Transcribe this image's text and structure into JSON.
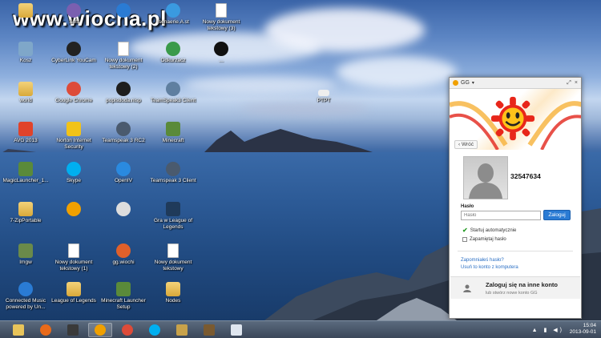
{
  "watermark": "www.wiocha.pl",
  "desktop_icons": [
    {
      "label": "",
      "icon": "folder-icon",
      "color": "#d9a93a",
      "col": 0,
      "row": 0
    },
    {
      "label": "Soft",
      "icon": "app-icon",
      "color": "#7a5fb0",
      "col": 1,
      "row": 0
    },
    {
      "label": "",
      "icon": "app-icon",
      "color": "#2a7bd4",
      "col": 2,
      "row": 0
    },
    {
      "label": "Isenaerie.A.st",
      "icon": "app-icon",
      "color": "#3a9ae0",
      "col": 3,
      "row": 0
    },
    {
      "label": "Nowy dokument tekstowy (3)",
      "icon": "document-icon",
      "color": "#ffffff",
      "col": 4,
      "row": 0
    },
    {
      "label": "Kosz",
      "icon": "recycle-bin-icon",
      "color": "#7fa7c9",
      "col": 0,
      "row": 1
    },
    {
      "label": "CyberLink YouCam",
      "icon": "app-icon",
      "color": "#222222",
      "col": 1,
      "row": 1
    },
    {
      "label": "Nowy dokument tekstowy (2)",
      "icon": "document-icon",
      "color": "#ffffff",
      "col": 2,
      "row": 1
    },
    {
      "label": "Odkurzacz",
      "icon": "app-icon",
      "color": "#3a9a4a",
      "col": 3,
      "row": 1
    },
    {
      "label": "…",
      "icon": "app-icon",
      "color": "#111111",
      "col": 4,
      "row": 1
    },
    {
      "label": "world",
      "icon": "folder-icon",
      "color": "#d9a93a",
      "col": 0,
      "row": 2
    },
    {
      "label": "Google Chrome",
      "icon": "chrome-icon",
      "color": "#dd4b39",
      "col": 1,
      "row": 2
    },
    {
      "label": "popisdoda.nisp",
      "icon": "app-icon",
      "color": "#1e1e1e",
      "col": 2,
      "row": 2
    },
    {
      "label": "TeamSpeak3 Client",
      "icon": "app-icon",
      "color": "#5f7fa0",
      "col": 3,
      "row": 2
    },
    {
      "label": "AVG 2013",
      "icon": "avg-icon",
      "color": "#e0432a",
      "col": 0,
      "row": 3
    },
    {
      "label": "Norton Internet Security",
      "icon": "norton-icon",
      "color": "#f2c318",
      "col": 1,
      "row": 3
    },
    {
      "label": "Teamspeak 3 RC2",
      "icon": "app-icon",
      "color": "#4a5a6e",
      "col": 2,
      "row": 3
    },
    {
      "label": "Minecraft",
      "icon": "minecraft-icon",
      "color": "#5a8a3a",
      "col": 3,
      "row": 3
    },
    {
      "label": "MagicLauncher_1...",
      "icon": "minecraft-icon",
      "color": "#5a8a3a",
      "col": 0,
      "row": 4
    },
    {
      "label": "Skype",
      "icon": "skype-icon",
      "color": "#00aff0",
      "col": 1,
      "row": 4
    },
    {
      "label": "OpenIV",
      "icon": "app-icon",
      "color": "#2a8ae0",
      "col": 2,
      "row": 4
    },
    {
      "label": "Teamspeak 3 Client",
      "icon": "app-icon",
      "color": "#4a5a6e",
      "col": 3,
      "row": 4
    },
    {
      "label": "7-ZipPortable",
      "icon": "folder-icon",
      "color": "#d9a93a",
      "col": 0,
      "row": 5
    },
    {
      "label": "",
      "icon": "gg-icon",
      "color": "#f0a000",
      "col": 1,
      "row": 5
    },
    {
      "label": "",
      "icon": "app-icon",
      "color": "#dddddd",
      "col": 2,
      "row": 5
    },
    {
      "label": "Gra w League of Legends",
      "icon": "lol-icon",
      "color": "#1f3a5a",
      "col": 3,
      "row": 5
    },
    {
      "label": "Imgw",
      "icon": "minecraft-icon",
      "color": "#6a8a4a",
      "col": 0,
      "row": 6
    },
    {
      "label": "Nowy dokument tekstowy (1)",
      "icon": "document-icon",
      "color": "#ffffff",
      "col": 1,
      "row": 6
    },
    {
      "label": "gg.wiochi",
      "icon": "app-icon",
      "color": "#e0602a",
      "col": 2,
      "row": 6
    },
    {
      "label": "Nowy dokument tekstowy",
      "icon": "document-icon",
      "color": "#ffffff",
      "col": 3,
      "row": 6
    },
    {
      "label": "Connected Music powered by Un...",
      "icon": "app-icon",
      "color": "#2a7bd4",
      "col": 0,
      "row": 7
    },
    {
      "label": "League of Legends",
      "icon": "folder-icon",
      "color": "#d9a93a",
      "col": 1,
      "row": 7
    },
    {
      "label": "Minecraft Launcher Setup",
      "icon": "minecraft-icon",
      "color": "#5a8a3a",
      "col": 2,
      "row": 7
    },
    {
      "label": "Nodes",
      "icon": "folder-icon",
      "color": "#d9a93a",
      "col": 3,
      "row": 7
    }
  ],
  "extra_icon": {
    "label": "PTPT",
    "icon": "app-icon"
  },
  "gg_window": {
    "title": "GG",
    "titlebar_buttons": [
      "⤢",
      "×"
    ],
    "back_label": "Wróć",
    "uin": "32547634",
    "password_label": "Hasło",
    "password_placeholder": "Hasło",
    "login_label": "Zaloguj",
    "auto_start_label": "Startuj automatycznie",
    "remember_label": "Zapamiętaj hasło",
    "forgot_label": "Zapomniałeś hasło?",
    "remove_label": "Usuń to konto z komputera",
    "other_account_title": "Zaloguj się na inne konto",
    "other_account_sub": "lub stwórz nowe konto GG",
    "accent": "#2a7bd4"
  },
  "taskbar": {
    "items": [
      {
        "icon": "file-explorer-icon"
      },
      {
        "icon": "firefox-icon"
      },
      {
        "icon": "media-player-icon"
      },
      {
        "icon": "gg-icon",
        "active": true
      },
      {
        "icon": "chrome-icon"
      },
      {
        "icon": "skype-icon"
      },
      {
        "icon": "league-of-legends-icon"
      },
      {
        "icon": "minecraft-icon"
      },
      {
        "icon": "paint-icon"
      }
    ],
    "tray_icons": "▲ ▮ ◀)",
    "time": "15:04",
    "date": "2013-09-01"
  }
}
